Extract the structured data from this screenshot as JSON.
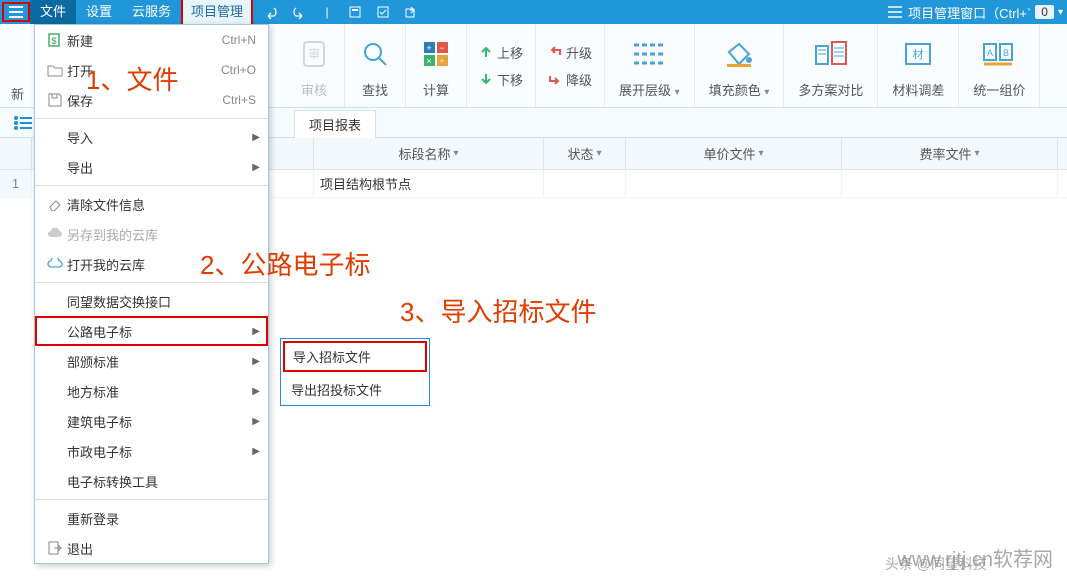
{
  "menubar": {
    "items": [
      "文件",
      "设置",
      "云服务",
      "项目管理"
    ],
    "right_label": "项目管理窗口（Ctrl+`",
    "right_num": "0"
  },
  "dropdown": {
    "new": "新建",
    "new_sc": "Ctrl+N",
    "open": "打开",
    "open_sc": "Ctrl+O",
    "save": "保存",
    "save_sc": "Ctrl+S",
    "import": "导入",
    "export": "导出",
    "clear": "清除文件信息",
    "savecloud": "另存到我的云库",
    "opencloud": "打开我的云库",
    "twexchange": "同望数据交换接口",
    "highway": "公路电子标",
    "ministry": "部颁标准",
    "local": "地方标准",
    "building": "建筑电子标",
    "municipal": "市政电子标",
    "ebidtool": "电子标转换工具",
    "relogin": "重新登录",
    "exit": "退出"
  },
  "submenu": {
    "import_bid": "导入招标文件",
    "export_bid": "导出招投标文件"
  },
  "annotations": {
    "a1": "1、文件",
    "a2": "2、公路电子标",
    "a3": "3、导入招标文件"
  },
  "ribbon": {
    "left_label": "新",
    "audit": "审核",
    "search": "查找",
    "calc": "计算",
    "up": "上移",
    "down": "下移",
    "promote": "升级",
    "demote": "降级",
    "expand": "展开层级",
    "fill": "填充颜色",
    "compare": "多方案对比",
    "material": "材料调差",
    "group": "统一组价"
  },
  "tabs2": {
    "report": "项目报表"
  },
  "table": {
    "headers": [
      "",
      "",
      "标段名称",
      "状态",
      "单价文件",
      "费率文件"
    ],
    "row_num": "1",
    "r1c2": "项目结构根节点"
  },
  "watermark": "www.rjtj.cn软荐网",
  "watermark2": "头条 @同望科技"
}
